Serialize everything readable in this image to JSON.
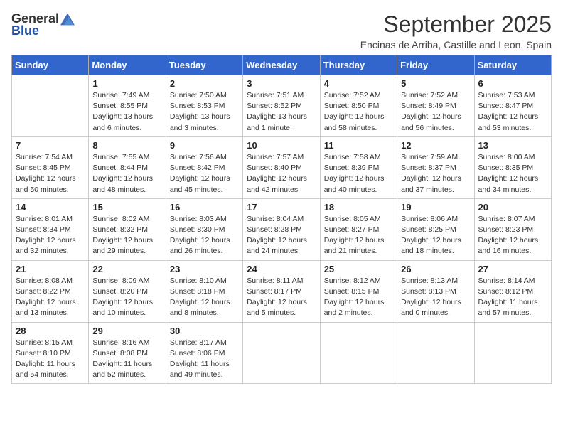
{
  "logo": {
    "general": "General",
    "blue": "Blue"
  },
  "header": {
    "title": "September 2025",
    "subtitle": "Encinas de Arriba, Castille and Leon, Spain"
  },
  "days_of_week": [
    "Sunday",
    "Monday",
    "Tuesday",
    "Wednesday",
    "Thursday",
    "Friday",
    "Saturday"
  ],
  "weeks": [
    [
      {
        "day": "",
        "sunrise": "",
        "sunset": "",
        "daylight": ""
      },
      {
        "day": "1",
        "sunrise": "Sunrise: 7:49 AM",
        "sunset": "Sunset: 8:55 PM",
        "daylight": "Daylight: 13 hours and 6 minutes."
      },
      {
        "day": "2",
        "sunrise": "Sunrise: 7:50 AM",
        "sunset": "Sunset: 8:53 PM",
        "daylight": "Daylight: 13 hours and 3 minutes."
      },
      {
        "day": "3",
        "sunrise": "Sunrise: 7:51 AM",
        "sunset": "Sunset: 8:52 PM",
        "daylight": "Daylight: 13 hours and 1 minute."
      },
      {
        "day": "4",
        "sunrise": "Sunrise: 7:52 AM",
        "sunset": "Sunset: 8:50 PM",
        "daylight": "Daylight: 12 hours and 58 minutes."
      },
      {
        "day": "5",
        "sunrise": "Sunrise: 7:52 AM",
        "sunset": "Sunset: 8:49 PM",
        "daylight": "Daylight: 12 hours and 56 minutes."
      },
      {
        "day": "6",
        "sunrise": "Sunrise: 7:53 AM",
        "sunset": "Sunset: 8:47 PM",
        "daylight": "Daylight: 12 hours and 53 minutes."
      }
    ],
    [
      {
        "day": "7",
        "sunrise": "Sunrise: 7:54 AM",
        "sunset": "Sunset: 8:45 PM",
        "daylight": "Daylight: 12 hours and 50 minutes."
      },
      {
        "day": "8",
        "sunrise": "Sunrise: 7:55 AM",
        "sunset": "Sunset: 8:44 PM",
        "daylight": "Daylight: 12 hours and 48 minutes."
      },
      {
        "day": "9",
        "sunrise": "Sunrise: 7:56 AM",
        "sunset": "Sunset: 8:42 PM",
        "daylight": "Daylight: 12 hours and 45 minutes."
      },
      {
        "day": "10",
        "sunrise": "Sunrise: 7:57 AM",
        "sunset": "Sunset: 8:40 PM",
        "daylight": "Daylight: 12 hours and 42 minutes."
      },
      {
        "day": "11",
        "sunrise": "Sunrise: 7:58 AM",
        "sunset": "Sunset: 8:39 PM",
        "daylight": "Daylight: 12 hours and 40 minutes."
      },
      {
        "day": "12",
        "sunrise": "Sunrise: 7:59 AM",
        "sunset": "Sunset: 8:37 PM",
        "daylight": "Daylight: 12 hours and 37 minutes."
      },
      {
        "day": "13",
        "sunrise": "Sunrise: 8:00 AM",
        "sunset": "Sunset: 8:35 PM",
        "daylight": "Daylight: 12 hours and 34 minutes."
      }
    ],
    [
      {
        "day": "14",
        "sunrise": "Sunrise: 8:01 AM",
        "sunset": "Sunset: 8:34 PM",
        "daylight": "Daylight: 12 hours and 32 minutes."
      },
      {
        "day": "15",
        "sunrise": "Sunrise: 8:02 AM",
        "sunset": "Sunset: 8:32 PM",
        "daylight": "Daylight: 12 hours and 29 minutes."
      },
      {
        "day": "16",
        "sunrise": "Sunrise: 8:03 AM",
        "sunset": "Sunset: 8:30 PM",
        "daylight": "Daylight: 12 hours and 26 minutes."
      },
      {
        "day": "17",
        "sunrise": "Sunrise: 8:04 AM",
        "sunset": "Sunset: 8:28 PM",
        "daylight": "Daylight: 12 hours and 24 minutes."
      },
      {
        "day": "18",
        "sunrise": "Sunrise: 8:05 AM",
        "sunset": "Sunset: 8:27 PM",
        "daylight": "Daylight: 12 hours and 21 minutes."
      },
      {
        "day": "19",
        "sunrise": "Sunrise: 8:06 AM",
        "sunset": "Sunset: 8:25 PM",
        "daylight": "Daylight: 12 hours and 18 minutes."
      },
      {
        "day": "20",
        "sunrise": "Sunrise: 8:07 AM",
        "sunset": "Sunset: 8:23 PM",
        "daylight": "Daylight: 12 hours and 16 minutes."
      }
    ],
    [
      {
        "day": "21",
        "sunrise": "Sunrise: 8:08 AM",
        "sunset": "Sunset: 8:22 PM",
        "daylight": "Daylight: 12 hours and 13 minutes."
      },
      {
        "day": "22",
        "sunrise": "Sunrise: 8:09 AM",
        "sunset": "Sunset: 8:20 PM",
        "daylight": "Daylight: 12 hours and 10 minutes."
      },
      {
        "day": "23",
        "sunrise": "Sunrise: 8:10 AM",
        "sunset": "Sunset: 8:18 PM",
        "daylight": "Daylight: 12 hours and 8 minutes."
      },
      {
        "day": "24",
        "sunrise": "Sunrise: 8:11 AM",
        "sunset": "Sunset: 8:17 PM",
        "daylight": "Daylight: 12 hours and 5 minutes."
      },
      {
        "day": "25",
        "sunrise": "Sunrise: 8:12 AM",
        "sunset": "Sunset: 8:15 PM",
        "daylight": "Daylight: 12 hours and 2 minutes."
      },
      {
        "day": "26",
        "sunrise": "Sunrise: 8:13 AM",
        "sunset": "Sunset: 8:13 PM",
        "daylight": "Daylight: 12 hours and 0 minutes."
      },
      {
        "day": "27",
        "sunrise": "Sunrise: 8:14 AM",
        "sunset": "Sunset: 8:12 PM",
        "daylight": "Daylight: 11 hours and 57 minutes."
      }
    ],
    [
      {
        "day": "28",
        "sunrise": "Sunrise: 8:15 AM",
        "sunset": "Sunset: 8:10 PM",
        "daylight": "Daylight: 11 hours and 54 minutes."
      },
      {
        "day": "29",
        "sunrise": "Sunrise: 8:16 AM",
        "sunset": "Sunset: 8:08 PM",
        "daylight": "Daylight: 11 hours and 52 minutes."
      },
      {
        "day": "30",
        "sunrise": "Sunrise: 8:17 AM",
        "sunset": "Sunset: 8:06 PM",
        "daylight": "Daylight: 11 hours and 49 minutes."
      },
      {
        "day": "",
        "sunrise": "",
        "sunset": "",
        "daylight": ""
      },
      {
        "day": "",
        "sunrise": "",
        "sunset": "",
        "daylight": ""
      },
      {
        "day": "",
        "sunrise": "",
        "sunset": "",
        "daylight": ""
      },
      {
        "day": "",
        "sunrise": "",
        "sunset": "",
        "daylight": ""
      }
    ]
  ]
}
